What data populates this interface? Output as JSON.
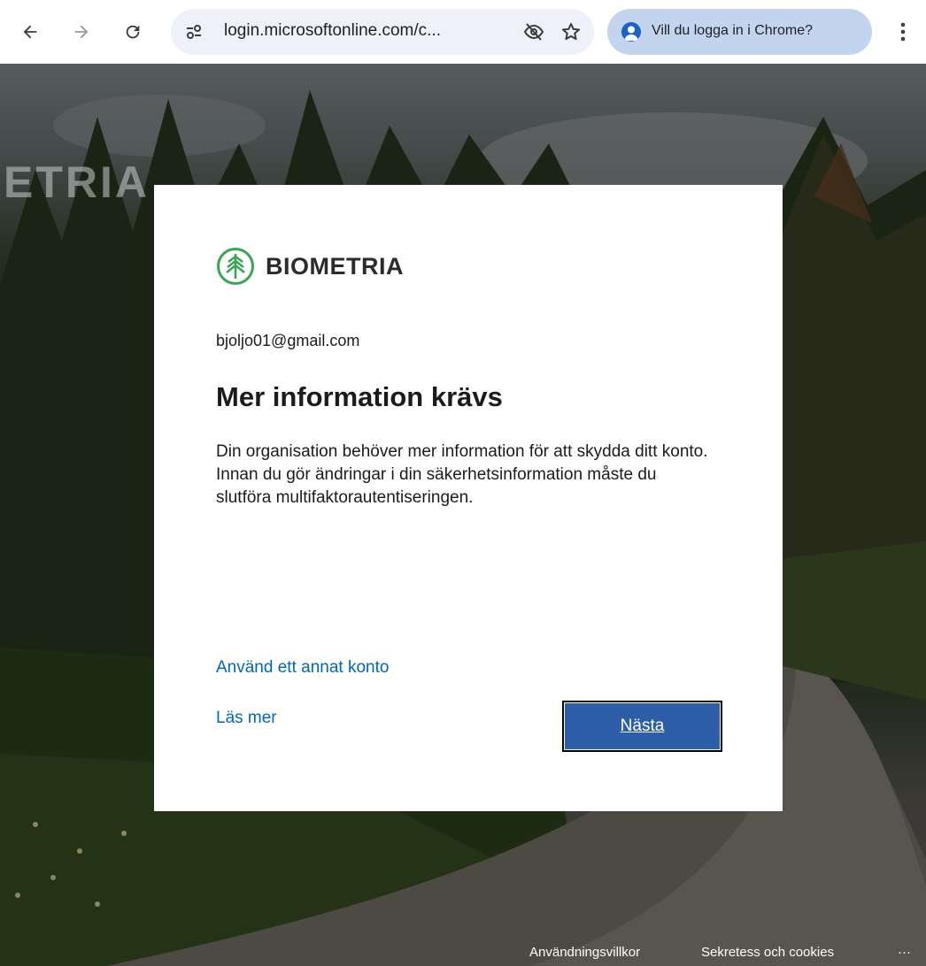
{
  "browser": {
    "url": "login.microsoftonline.com/c...",
    "profile_prompt": "Vill du logga in i Chrome?",
    "icons": {
      "back": "arrow-left-icon",
      "forward": "arrow-right-icon",
      "reload": "reload-icon",
      "site_info": "tune-icon",
      "tracking": "eye-off-icon",
      "bookmark": "star-icon",
      "profile": "person-icon",
      "menu": "kebab-menu-icon"
    }
  },
  "background": {
    "brand_text": "ETRIA"
  },
  "card": {
    "logo_text": "BIOMETRIA",
    "account_email": "bjoljo01@gmail.com",
    "title": "Mer information krävs",
    "description": "Din organisation behöver mer information för att skydda ditt konto. Innan du gör ändringar i din säkerhetsinformation måste du slutföra multifaktorautentiseringen.",
    "links": {
      "other_account": "Använd ett annat konto",
      "learn_more": "Läs mer"
    },
    "next_button": "Nästa"
  },
  "footer": {
    "terms": "Användningsvillkor",
    "privacy": "Sekretess och cookies",
    "more": "···"
  },
  "colors": {
    "link": "#0067b8",
    "button": "#2d5fa8",
    "logo_green": "#3aa655",
    "profile_pill": "#c3d4ee"
  }
}
